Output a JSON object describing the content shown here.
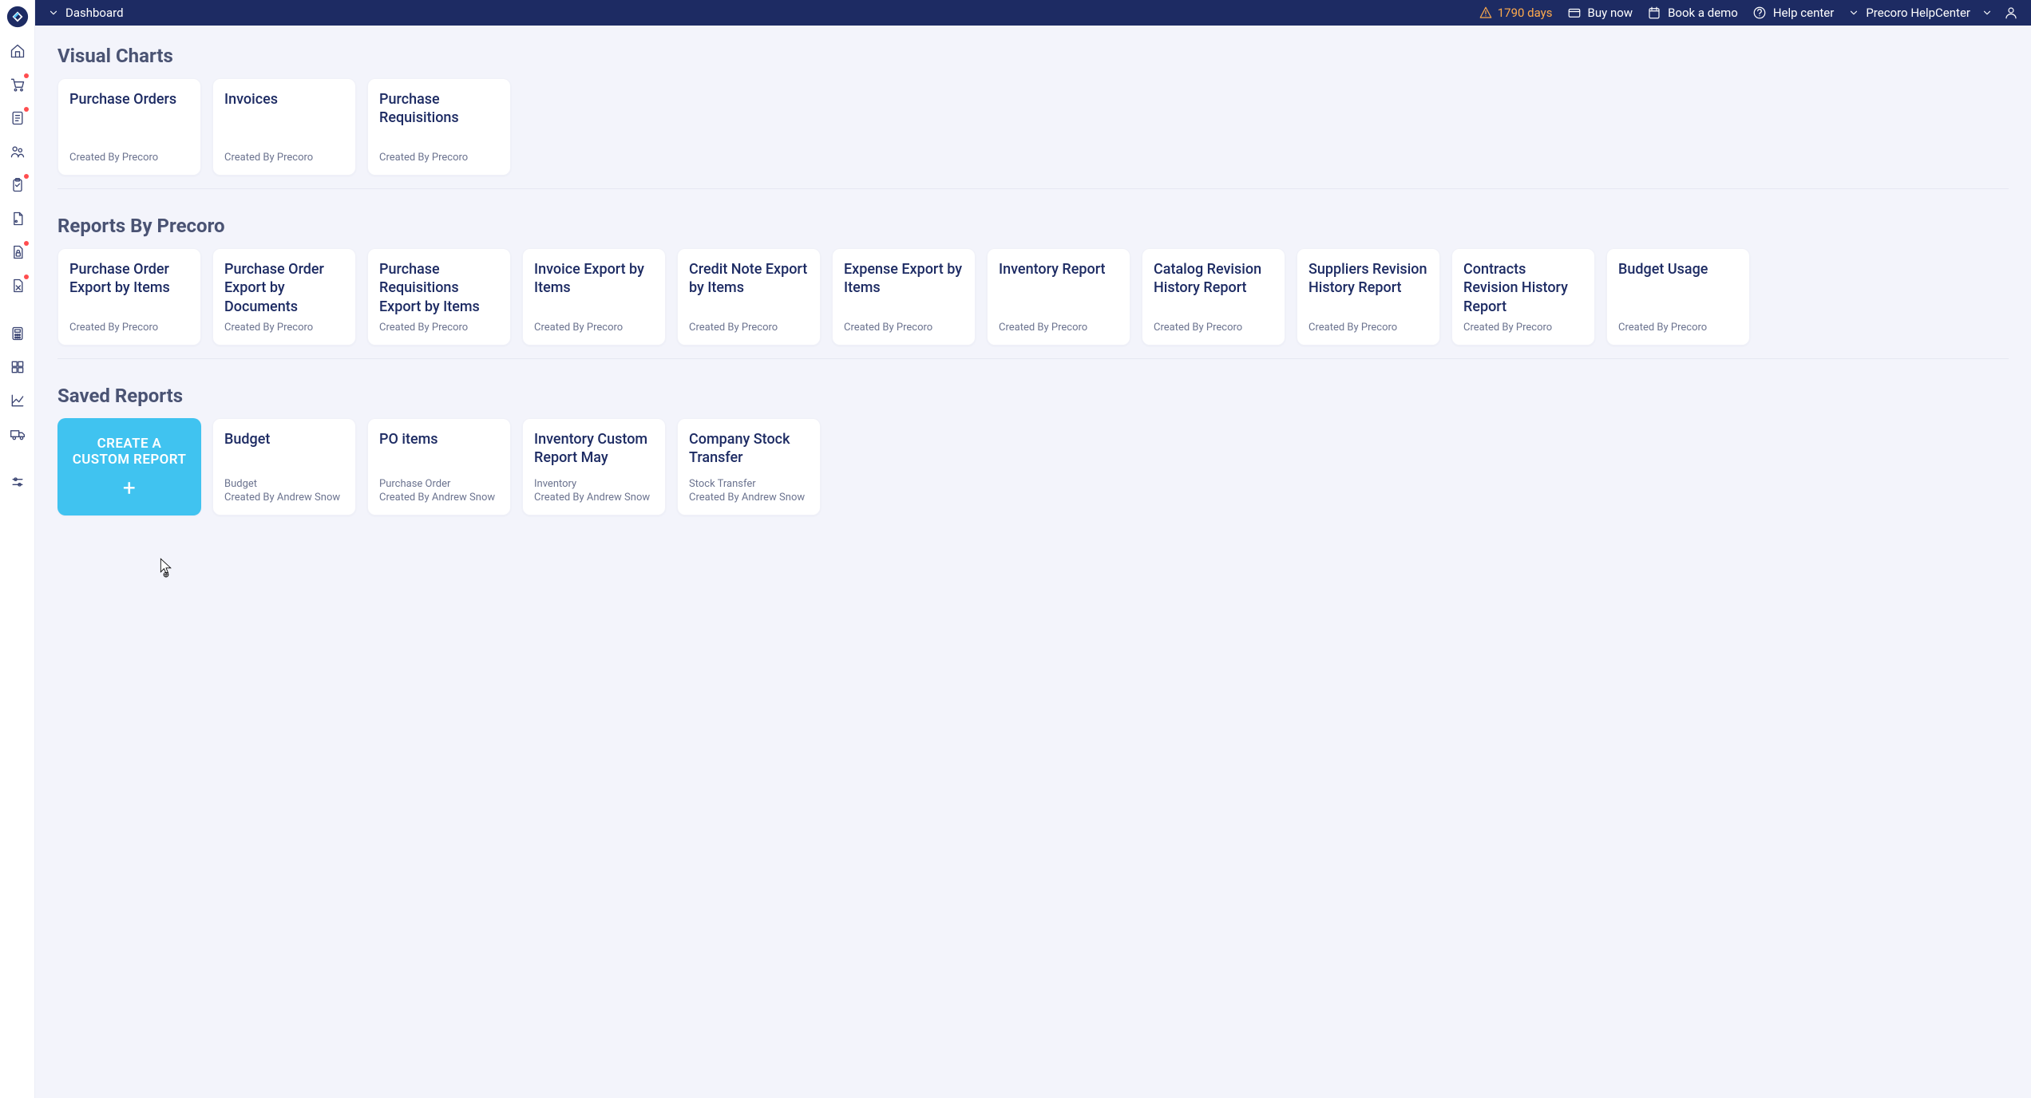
{
  "sidebar": {
    "logo": "precoro-logo",
    "items": [
      {
        "icon": "home",
        "dot": false
      },
      {
        "icon": "cart",
        "dot": true
      },
      {
        "icon": "receipt",
        "dot": true
      },
      {
        "icon": "people",
        "dot": false
      },
      {
        "icon": "clipboard",
        "dot": true
      },
      {
        "icon": "document",
        "dot": false
      },
      {
        "icon": "doc-lock",
        "dot": true
      },
      {
        "icon": "doc-x",
        "dot": true
      },
      {
        "icon": "calculator",
        "dot": false
      },
      {
        "icon": "boxes",
        "dot": false
      },
      {
        "icon": "chart",
        "dot": false
      },
      {
        "icon": "truck",
        "dot": false
      },
      {
        "icon": "sliders",
        "dot": false
      }
    ]
  },
  "header": {
    "breadcrumb_label": "Dashboard",
    "days_label": "1790 days",
    "buy_label": "Buy now",
    "demo_label": "Book a demo",
    "help_label": "Help center",
    "org_label": "Precoro HelpCenter"
  },
  "sections": {
    "visual_charts": {
      "title": "Visual Charts",
      "cards": [
        {
          "title": "Purchase Orders",
          "meta": "Created By Precoro"
        },
        {
          "title": "Invoices",
          "meta": "Created By Precoro"
        },
        {
          "title": "Purchase Requisitions",
          "meta": "Created By Precoro"
        }
      ]
    },
    "reports_precoro": {
      "title": "Reports By Precoro",
      "cards": [
        {
          "title": "Purchase Order Export by Items",
          "meta": "Created By Precoro"
        },
        {
          "title": "Purchase Order Export by Documents",
          "meta": "Created By Precoro"
        },
        {
          "title": "Purchase Requisitions Export by Items",
          "meta": "Created By Precoro"
        },
        {
          "title": "Invoice Export by Items",
          "meta": "Created By Precoro"
        },
        {
          "title": "Credit Note Export by Items",
          "meta": "Created By Precoro"
        },
        {
          "title": "Expense Export by Items",
          "meta": "Created By Precoro"
        },
        {
          "title": "Inventory Report",
          "meta": "Created By Precoro"
        },
        {
          "title": "Catalog Revision History Report",
          "meta": "Created By Precoro"
        },
        {
          "title": "Suppliers Revision History Report",
          "meta": "Created By Precoro"
        },
        {
          "title": "Contracts Revision History Report",
          "meta": "Created By Precoro"
        },
        {
          "title": "Budget Usage",
          "meta": "Created By Precoro"
        }
      ]
    },
    "saved_reports": {
      "title": "Saved Reports",
      "create_label": "CREATE A CUSTOM REPORT",
      "cards": [
        {
          "title": "Budget",
          "type": "Budget",
          "by": "Created By Andrew Snow"
        },
        {
          "title": "PO items",
          "type": "Purchase Order",
          "by": "Created By Andrew Snow"
        },
        {
          "title": "Inventory Custom Report May",
          "type": "Inventory",
          "by": "Created By Andrew Snow"
        },
        {
          "title": "Company Stock Transfer",
          "type": "Stock Transfer",
          "by": "Created By Andrew Snow"
        }
      ]
    }
  }
}
